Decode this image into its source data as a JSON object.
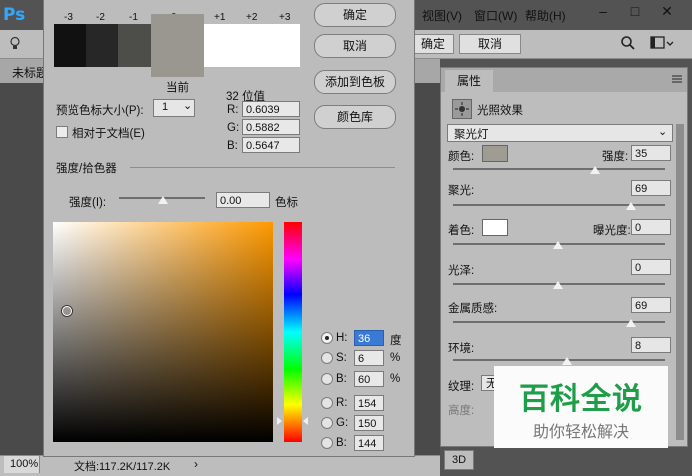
{
  "app": {
    "logo": "Ps"
  },
  "menu": [
    "视图(V)",
    "窗口(W)",
    "帮助(H)"
  ],
  "window_controls": {
    "minimize": "–",
    "maximize": "□",
    "close": "✕"
  },
  "options_bar": {
    "confirm_label": "确定",
    "cancel_label": "取消"
  },
  "document": {
    "tab_label": "未标题",
    "zoom": "100%",
    "file_info": "文档:117.2K/117.2K"
  },
  "dialog": {
    "ok_label": "确定",
    "cancel_label": "取消",
    "add_swatch_label": "添加到色板",
    "color_library_label": "颜色库",
    "swatch_labels": [
      "-3",
      "-2",
      "-1",
      "0",
      "+1",
      "+2",
      "+3"
    ],
    "current_label": "当前",
    "preview_size_label": "预览色标大小(P):",
    "preview_size_value": "1",
    "relative_label": "相对于文档(E)",
    "bit_label": "32 位值",
    "r_label": "R:",
    "r_value": "0.6039",
    "g_label": "G:",
    "g_value": "0.5882",
    "b_label": "B:",
    "b_value": "0.5647",
    "section_title": "强度/拾色器",
    "intensity_label": "强度(I):",
    "intensity_value": "0.00",
    "intensity_unit": "色标",
    "fields": [
      {
        "label": "H:",
        "value": "36",
        "unit": "度",
        "selected": true
      },
      {
        "label": "S:",
        "value": "6",
        "unit": "%",
        "selected": false
      },
      {
        "label": "B:",
        "value": "60",
        "unit": "%",
        "selected": false
      },
      {
        "label": "R:",
        "value": "154",
        "unit": "",
        "selected": false
      },
      {
        "label": "G:",
        "value": "150",
        "unit": "",
        "selected": false
      },
      {
        "label": "B:",
        "value": "144",
        "unit": "",
        "selected": false
      }
    ]
  },
  "properties": {
    "tab_label": "属性",
    "header_label": "光照效果",
    "light_type": "聚光灯",
    "color_label": "颜色:",
    "intensity_label": "强度:",
    "intensity_value": "35",
    "hotspot_label": "聚光:",
    "hotspot_value": "69",
    "colorize_label": "着色:",
    "exposure_label": "曝光度:",
    "exposure_value": "0",
    "gloss_label": "光泽:",
    "gloss_value": "0",
    "metallic_label": "金属质感:",
    "metallic_value": "69",
    "ambience_label": "环境:",
    "ambience_value": "8",
    "texture_label": "纹理:",
    "texture_value": "无",
    "height_label": "高度:",
    "panel_3d_label": "3D"
  },
  "watermark": {
    "title": "百科全说",
    "subtitle": "助你轻松解决"
  },
  "colors": {
    "current": "#9a9690",
    "light_color": "#9f9c93",
    "colorize": "#ffffff",
    "accent": "#31a8ff"
  }
}
